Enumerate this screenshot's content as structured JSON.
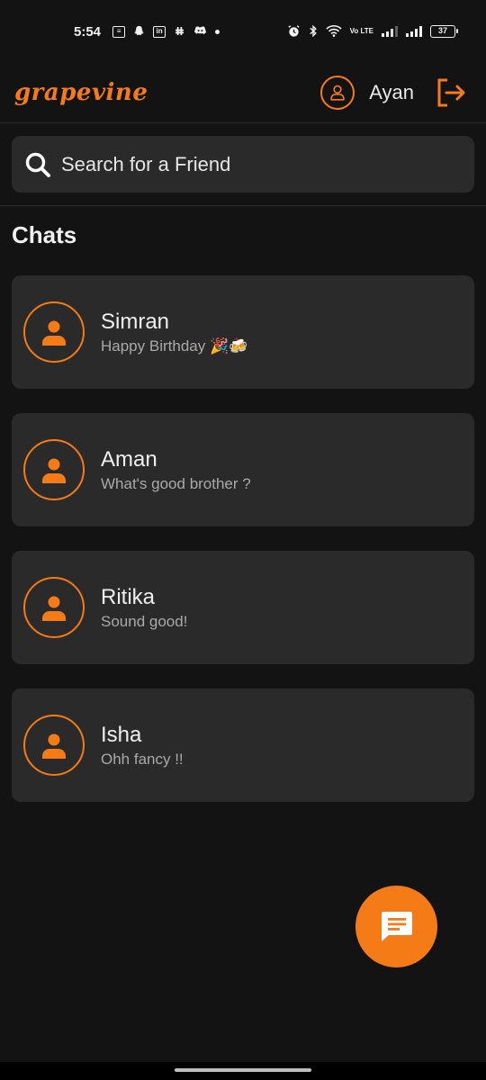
{
  "status_bar": {
    "time": "5:54",
    "battery": "37",
    "left_icons": [
      "news-icon",
      "snapchat-icon",
      "linkedin-icon",
      "slack-icon",
      "discord-icon",
      "dot-icon"
    ],
    "right_icons": [
      "alarm-icon",
      "bluetooth-icon",
      "wifi-icon",
      "volte-icon",
      "signal-icon",
      "signal-icon",
      "battery-icon"
    ],
    "volte": "Vo LTE"
  },
  "header": {
    "logo": "grapevine",
    "user_name": "Ayan",
    "accent_color": "#f47b16"
  },
  "search": {
    "placeholder": "Search for a Friend"
  },
  "section_title": "Chats",
  "chats": [
    {
      "name": "Simran",
      "preview": "Happy Birthday 🎉🍻"
    },
    {
      "name": "Aman",
      "preview": "What's good brother ?"
    },
    {
      "name": "Ritika",
      "preview": "Sound good!"
    },
    {
      "name": "Isha",
      "preview": "Ohh fancy !!"
    }
  ],
  "fab": {
    "icon": "message-icon"
  }
}
